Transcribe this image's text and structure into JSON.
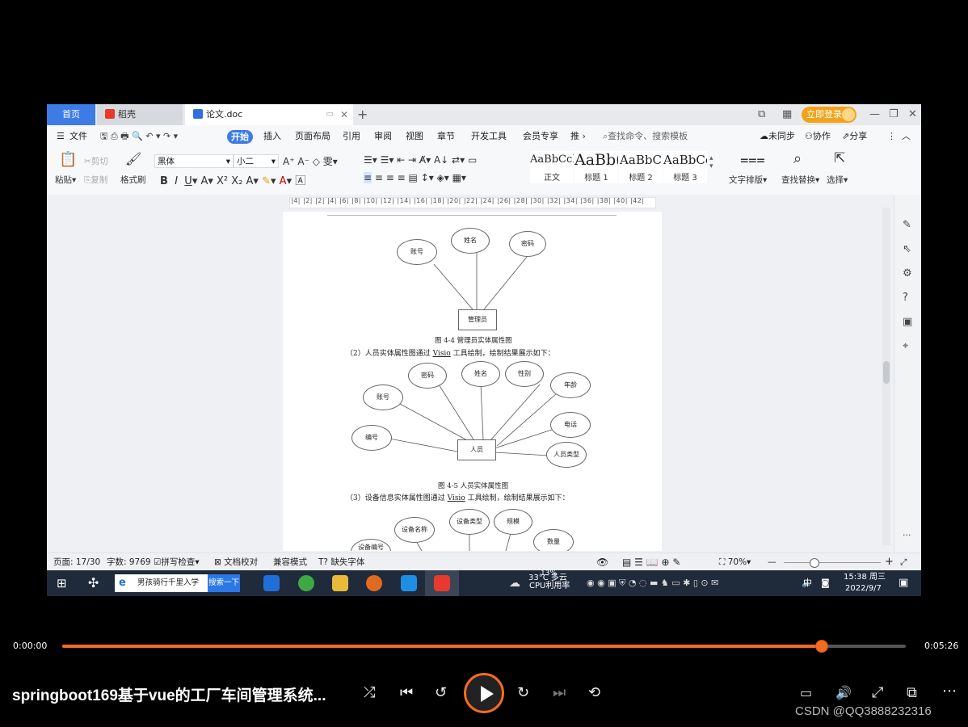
{
  "app": {
    "tabs": [
      {
        "label": "首页"
      },
      {
        "label": "稻壳"
      },
      {
        "label": "论文.doc"
      }
    ],
    "login_label": "立即登录"
  },
  "menu": {
    "file": "文件",
    "items": [
      "开始",
      "插入",
      "页面布局",
      "引用",
      "审阅",
      "视图",
      "章节",
      "开发工具",
      "会员专享",
      "推"
    ],
    "search_placeholder": "查找命令、搜索模板",
    "sync": "未同步",
    "collab": "协作",
    "share": "分享"
  },
  "ribbon": {
    "paste": "粘贴",
    "cut": "剪切",
    "copy": "复制",
    "format_painter": "格式刷",
    "font_name": "黑体",
    "font_size": "小二",
    "styles": [
      {
        "sample": "AaBbCcI",
        "name": "正文"
      },
      {
        "sample": "AaBb(",
        "name": "标题 1"
      },
      {
        "sample": "AaBbC",
        "name": "标题 2"
      },
      {
        "sample": "AaBbCc",
        "name": "标题 3"
      }
    ],
    "text_layout": "文字排版",
    "find_replace": "查找替换",
    "select": "选择"
  },
  "ruler": {
    "text": "|4| |2| |2| |4| |6| |8| |10| |12| |14| |16| |18| |20| |22| |24| |26| |28| |30| |32| |34| |36| |38| |40| |42|"
  },
  "document": {
    "fig1": {
      "attributes": [
        "账号",
        "姓名",
        "密码"
      ],
      "entity": "管理员",
      "caption": "图 4-4  管理员实体属性图"
    },
    "para2": {
      "before": "（2）人员实体属性图通过 ",
      "tool": "Visio",
      "after": " 工具绘制，绘制结果展示如下："
    },
    "fig2": {
      "attributes": [
        "密码",
        "姓名",
        "性别",
        "年龄",
        "账号",
        "电话",
        "编号",
        "人员类型"
      ],
      "entity": "人员",
      "caption": "图 4-5  人员实体属性图"
    },
    "para3": {
      "before": "（3）设备信息实体属性图通过 ",
      "tool": "Visio",
      "after": " 工具绘制，绘制结果展示如下："
    },
    "fig3": {
      "attributes": [
        "设备名称",
        "设备类型",
        "规模",
        "数量",
        "设备编号"
      ]
    }
  },
  "status": {
    "page": "页面: 17/30",
    "words": "字数: 9769",
    "spell": "拼写检查",
    "proof": "文档校对",
    "compat": "兼容模式",
    "missing_font": "缺失字体",
    "zoom": "70%"
  },
  "taskbar": {
    "search_text": "男孩骑行千里入学",
    "search_button": "搜索一下",
    "weather": "33°C 多云",
    "cpu_percent": "13%",
    "cpu_label": "CPU利用率",
    "ime": "中",
    "time": "15:38 周三",
    "date": "2022/9/7"
  },
  "player": {
    "current_time": "0:00:00",
    "total_time": "0:05:26",
    "progress_fraction": 0.9,
    "title": "springboot169基于vue的工厂车间管理系统...",
    "watermark": "CSDN @QQ3888232316",
    "accent_color": "#f36b23"
  }
}
